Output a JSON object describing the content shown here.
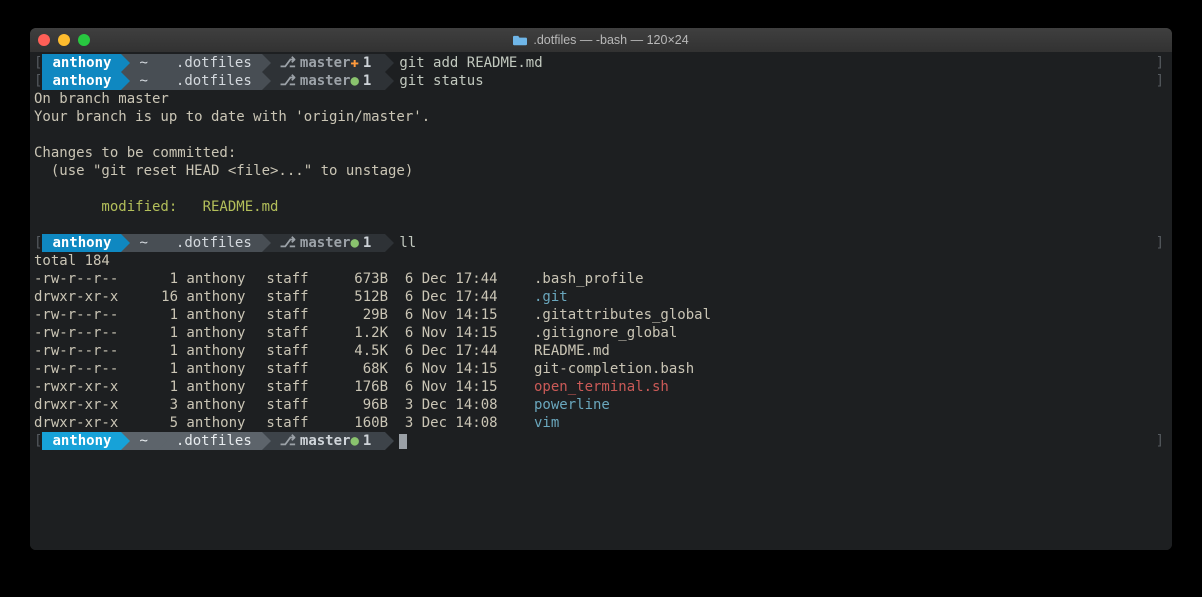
{
  "window": {
    "title": ".dotfiles — -bash — 120×24"
  },
  "prompts": [
    {
      "user": "anthony",
      "home": "~",
      "dir": ".dotfiles",
      "branch": "master",
      "status": "plus",
      "count": "1",
      "cmd": "git add README.md",
      "active": false
    },
    {
      "user": "anthony",
      "home": "~",
      "dir": ".dotfiles",
      "branch": "master",
      "status": "dot",
      "count": "1",
      "cmd": "git status",
      "active": false
    },
    {
      "user": "anthony",
      "home": "~",
      "dir": ".dotfiles",
      "branch": "master",
      "status": "dot",
      "count": "1",
      "cmd": "ll",
      "active": false
    },
    {
      "user": "anthony",
      "home": "~",
      "dir": ".dotfiles",
      "branch": "master",
      "status": "dot",
      "count": "1",
      "cmd": "",
      "active": true
    }
  ],
  "git_status": {
    "l1": "On branch master",
    "l2": "Your branch is up to date with 'origin/master'.",
    "l3": "Changes to be committed:",
    "l4": "  (use \"git reset HEAD <file>...\" to unstage)",
    "l5": "        modified:   README.md"
  },
  "ll": {
    "total": "total 184",
    "rows": [
      {
        "perm": "-rw-r--r--",
        "ln": "1",
        "usr": "anthony",
        "grp": "staff",
        "sz": "673B",
        "dt": " 6 Dec 17:44",
        "name": ".bash_profile",
        "cls": ""
      },
      {
        "perm": "drwxr-xr-x",
        "ln": "16",
        "usr": "anthony",
        "grp": "staff",
        "sz": "512B",
        "dt": " 6 Dec 17:44",
        "name": ".git",
        "cls": "fn-blue"
      },
      {
        "perm": "-rw-r--r--",
        "ln": "1",
        "usr": "anthony",
        "grp": "staff",
        "sz": "29B",
        "dt": " 6 Nov 14:15",
        "name": ".gitattributes_global",
        "cls": ""
      },
      {
        "perm": "-rw-r--r--",
        "ln": "1",
        "usr": "anthony",
        "grp": "staff",
        "sz": "1.2K",
        "dt": " 6 Nov 14:15",
        "name": ".gitignore_global",
        "cls": ""
      },
      {
        "perm": "-rw-r--r--",
        "ln": "1",
        "usr": "anthony",
        "grp": "staff",
        "sz": "4.5K",
        "dt": " 6 Dec 17:44",
        "name": "README.md",
        "cls": ""
      },
      {
        "perm": "-rw-r--r--",
        "ln": "1",
        "usr": "anthony",
        "grp": "staff",
        "sz": "68K",
        "dt": " 6 Nov 14:15",
        "name": "git-completion.bash",
        "cls": ""
      },
      {
        "perm": "-rwxr-xr-x",
        "ln": "1",
        "usr": "anthony",
        "grp": "staff",
        "sz": "176B",
        "dt": " 6 Nov 14:15",
        "name": "open_terminal.sh",
        "cls": "fn-red"
      },
      {
        "perm": "drwxr-xr-x",
        "ln": "3",
        "usr": "anthony",
        "grp": "staff",
        "sz": "96B",
        "dt": " 3 Dec 14:08",
        "name": "powerline",
        "cls": "fn-blue"
      },
      {
        "perm": "drwxr-xr-x",
        "ln": "5",
        "usr": "anthony",
        "grp": "staff",
        "sz": "160B",
        "dt": " 3 Dec 14:08",
        "name": "vim",
        "cls": "fn-blue"
      }
    ]
  }
}
